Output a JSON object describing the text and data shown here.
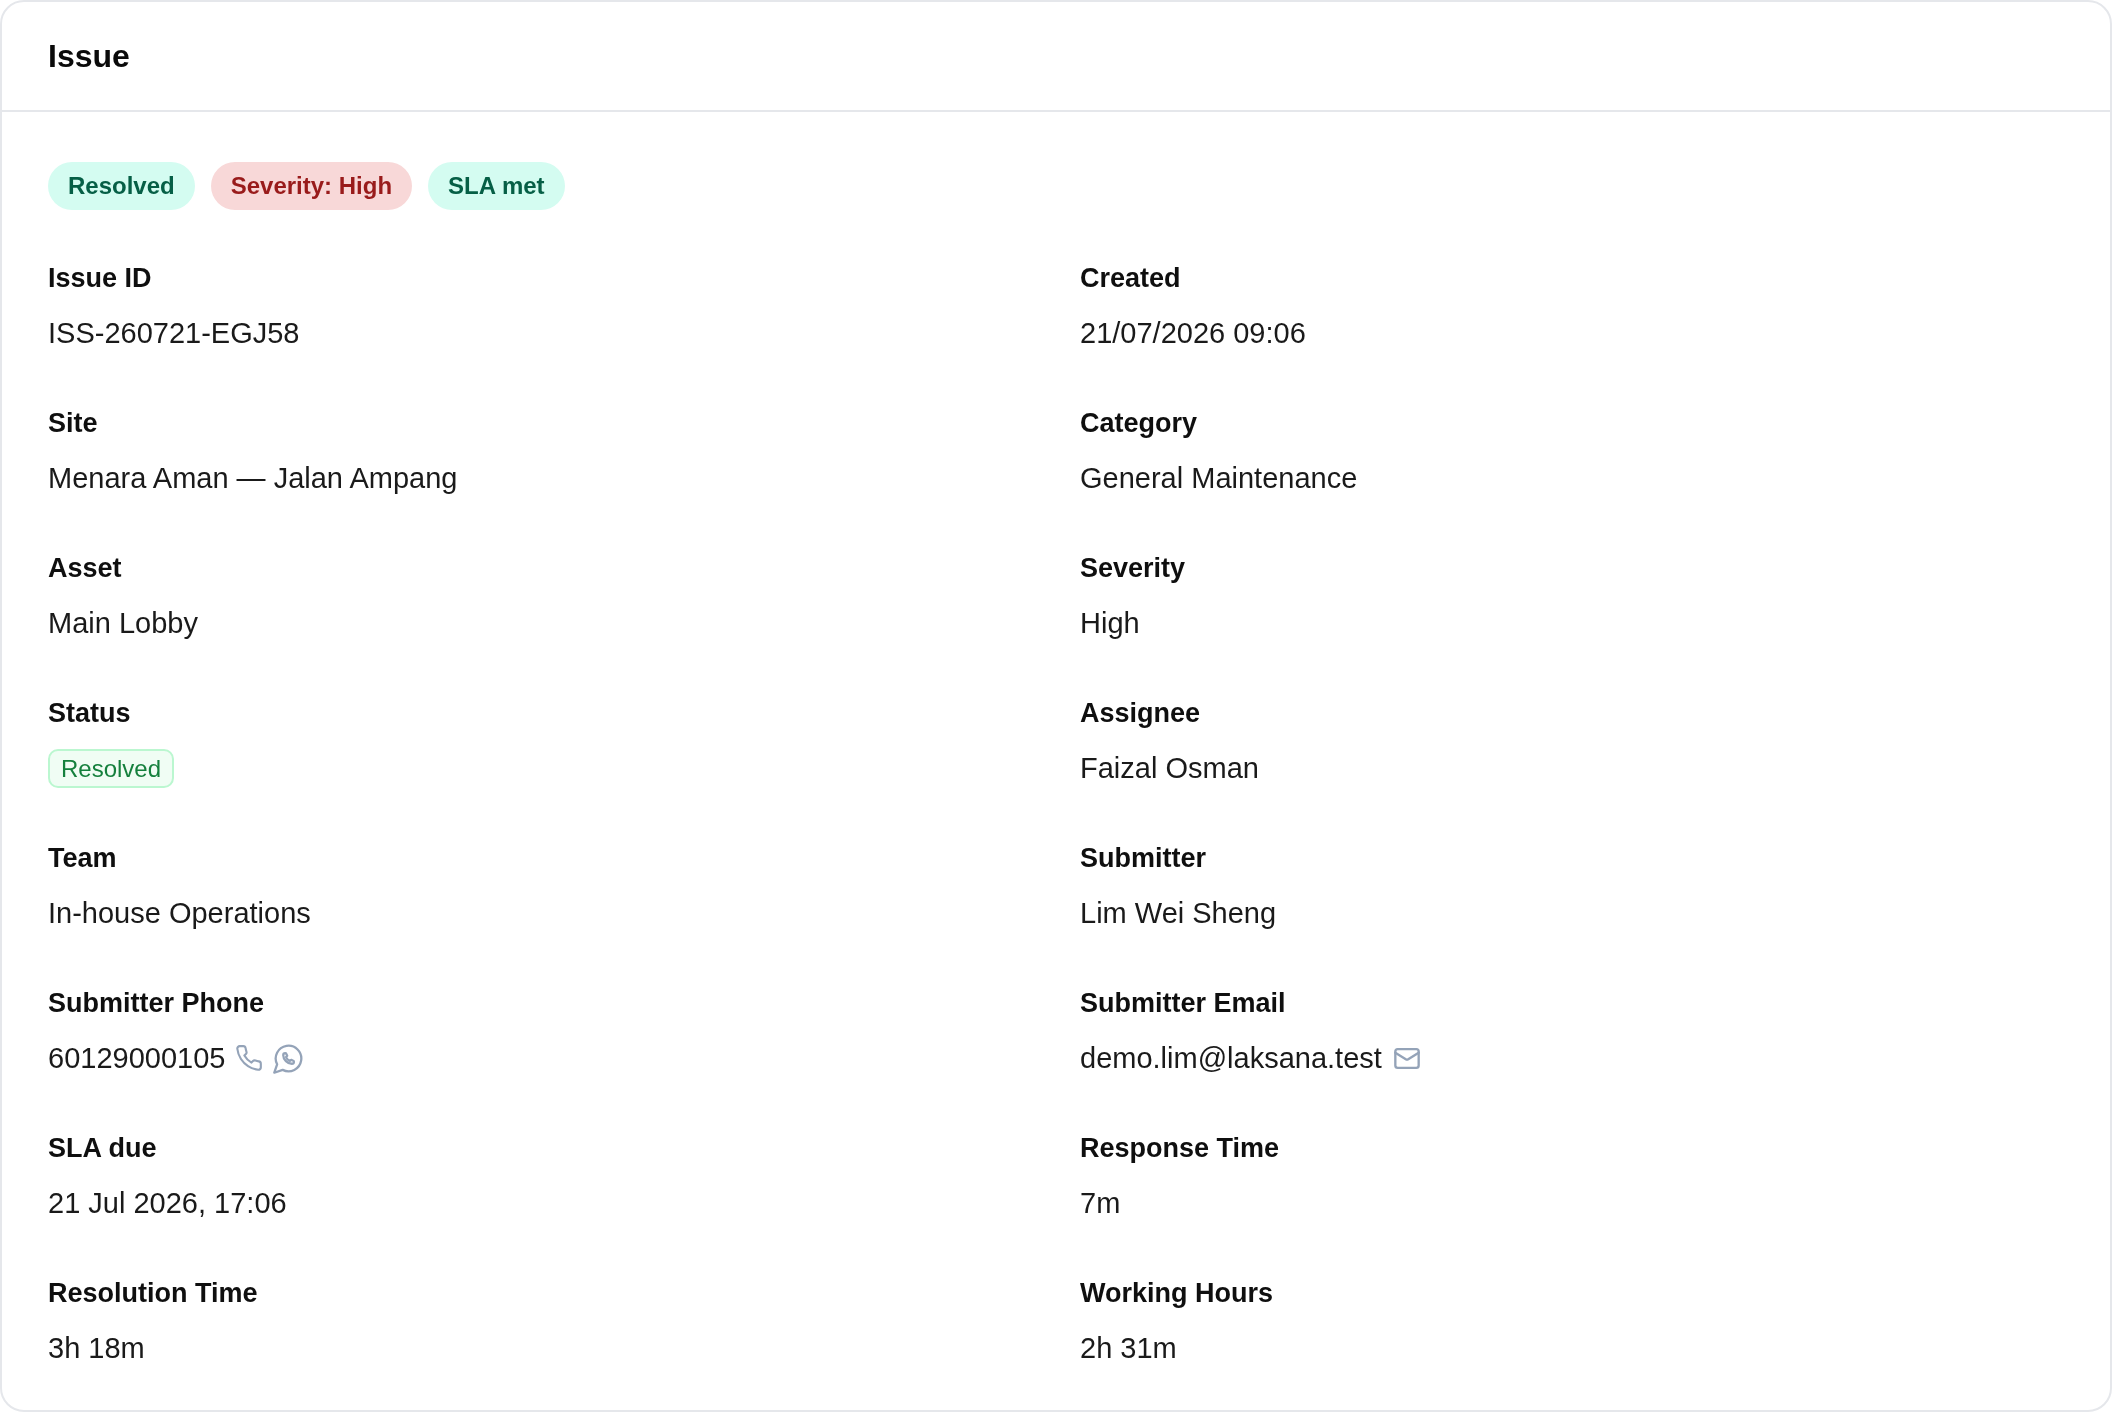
{
  "header": {
    "title": "Issue"
  },
  "badges": [
    {
      "label": "Resolved",
      "color": "#065f46"
    },
    {
      "label": "Severity: High",
      "color": "#991b1b"
    },
    {
      "label": "SLA met",
      "color": "#065f46"
    }
  ],
  "fields": [
    {
      "label": "Issue ID",
      "value": "ISS-260721-EGJ58",
      "kind": "text"
    },
    {
      "label": "Created",
      "value": "21/07/2026 09:06",
      "kind": "text"
    },
    {
      "label": "Site",
      "value": "Menara Aman — Jalan Ampang",
      "kind": "text"
    },
    {
      "label": "Category",
      "value": "General Maintenance",
      "kind": "text"
    },
    {
      "label": "Asset",
      "value": "Main Lobby",
      "kind": "text"
    },
    {
      "label": "Severity",
      "value": "High",
      "kind": "text"
    },
    {
      "label": "Status",
      "value": "Resolved",
      "kind": "badge"
    },
    {
      "label": "Assignee",
      "value": "Faizal Osman",
      "kind": "text"
    },
    {
      "label": "Team",
      "value": "In-house Operations",
      "kind": "text"
    },
    {
      "label": "Submitter",
      "value": "Lim Wei Sheng",
      "kind": "text"
    },
    {
      "label": "Submitter Phone",
      "value": "60129000105",
      "kind": "phone"
    },
    {
      "label": "Submitter Email",
      "value": "demo.lim@laksana.test",
      "kind": "email"
    },
    {
      "label": "SLA due",
      "value": "21 Jul 2026, 17:06",
      "kind": "text"
    },
    {
      "label": "Response Time",
      "value": "7m",
      "kind": "text"
    },
    {
      "label": "Resolution Time",
      "value": "3h 18m",
      "kind": "text"
    },
    {
      "label": "Working Hours",
      "value": "2h 31m",
      "kind": "text"
    }
  ]
}
